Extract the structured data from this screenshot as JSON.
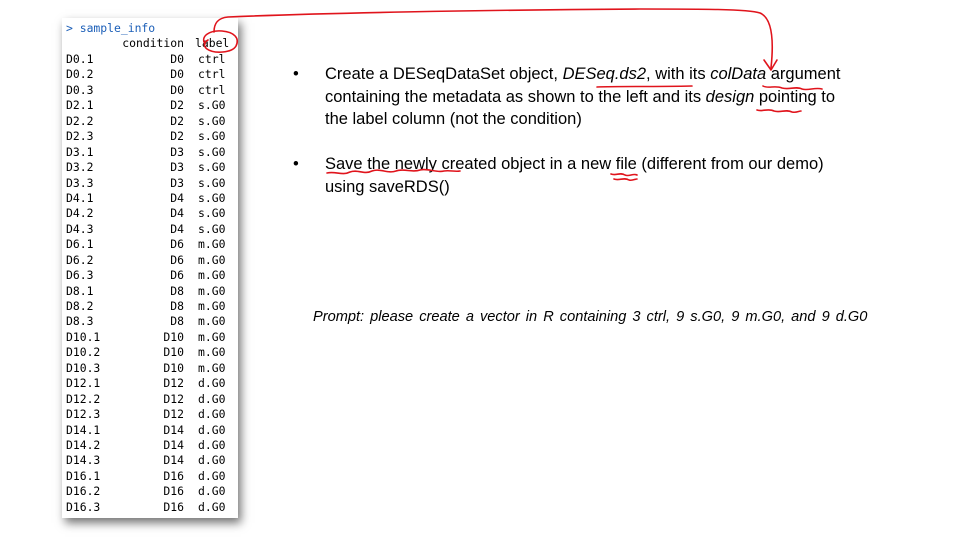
{
  "console": {
    "prompt_line": "> sample_info",
    "header": {
      "condition": "condition",
      "label": "label"
    },
    "rows": [
      {
        "name": "D0.1",
        "condition": "D0",
        "label": "ctrl"
      },
      {
        "name": "D0.2",
        "condition": "D0",
        "label": "ctrl"
      },
      {
        "name": "D0.3",
        "condition": "D0",
        "label": "ctrl"
      },
      {
        "name": "D2.1",
        "condition": "D2",
        "label": "s.G0"
      },
      {
        "name": "D2.2",
        "condition": "D2",
        "label": "s.G0"
      },
      {
        "name": "D2.3",
        "condition": "D2",
        "label": "s.G0"
      },
      {
        "name": "D3.1",
        "condition": "D3",
        "label": "s.G0"
      },
      {
        "name": "D3.2",
        "condition": "D3",
        "label": "s.G0"
      },
      {
        "name": "D3.3",
        "condition": "D3",
        "label": "s.G0"
      },
      {
        "name": "D4.1",
        "condition": "D4",
        "label": "s.G0"
      },
      {
        "name": "D4.2",
        "condition": "D4",
        "label": "s.G0"
      },
      {
        "name": "D4.3",
        "condition": "D4",
        "label": "s.G0"
      },
      {
        "name": "D6.1",
        "condition": "D6",
        "label": "m.G0"
      },
      {
        "name": "D6.2",
        "condition": "D6",
        "label": "m.G0"
      },
      {
        "name": "D6.3",
        "condition": "D6",
        "label": "m.G0"
      },
      {
        "name": "D8.1",
        "condition": "D8",
        "label": "m.G0"
      },
      {
        "name": "D8.2",
        "condition": "D8",
        "label": "m.G0"
      },
      {
        "name": "D8.3",
        "condition": "D8",
        "label": "m.G0"
      },
      {
        "name": "D10.1",
        "condition": "D10",
        "label": "m.G0"
      },
      {
        "name": "D10.2",
        "condition": "D10",
        "label": "m.G0"
      },
      {
        "name": "D10.3",
        "condition": "D10",
        "label": "m.G0"
      },
      {
        "name": "D12.1",
        "condition": "D12",
        "label": "d.G0"
      },
      {
        "name": "D12.2",
        "condition": "D12",
        "label": "d.G0"
      },
      {
        "name": "D12.3",
        "condition": "D12",
        "label": "d.G0"
      },
      {
        "name": "D14.1",
        "condition": "D14",
        "label": "d.G0"
      },
      {
        "name": "D14.2",
        "condition": "D14",
        "label": "d.G0"
      },
      {
        "name": "D14.3",
        "condition": "D14",
        "label": "d.G0"
      },
      {
        "name": "D16.1",
        "condition": "D16",
        "label": "d.G0"
      },
      {
        "name": "D16.2",
        "condition": "D16",
        "label": "d.G0"
      },
      {
        "name": "D16.3",
        "condition": "D16",
        "label": "d.G0"
      }
    ]
  },
  "bullets": {
    "marker": "•",
    "b1": {
      "l1_pre": "Create a DESeqDataSet object, ",
      "l1_obj": "DESeq.ds2",
      "l1_mid": ", with its ",
      "l1_arg": "colData",
      "l1_post": " argument",
      "l2_pre": "containing the metadata as shown to the left and its ",
      "l2_design": "design",
      "l2_post": " pointing to",
      "l3": "the label column (not the condition)"
    },
    "b2": {
      "l1": "Save the newly created object in a new file (different from our demo)",
      "l2": "using saveRDS()"
    }
  },
  "prompt": "Prompt:  please  create  a  vector  in  R  containing  3  ctrl, 9  s.G0,  9  m.G0,  and  9  d.G0",
  "colors": {
    "annotation_red": "#e0141c",
    "console_prompt_blue": "#1c5fb8"
  }
}
